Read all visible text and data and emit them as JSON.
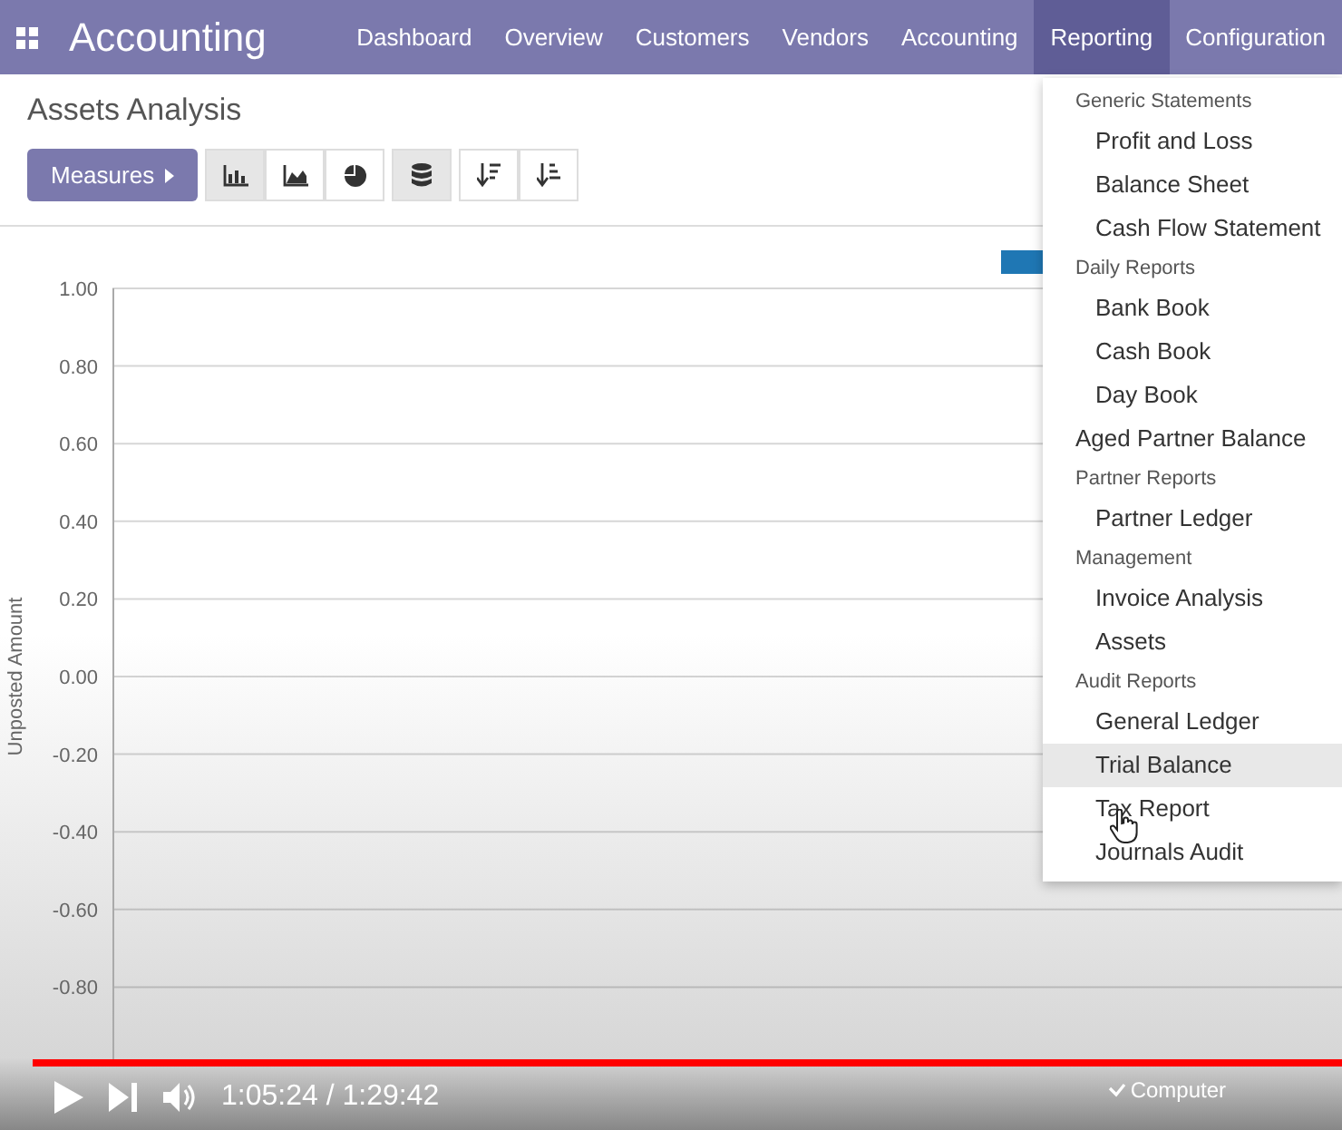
{
  "navbar": {
    "app_title": "Accounting",
    "menu": [
      {
        "label": "Dashboard",
        "selected": false
      },
      {
        "label": "Overview",
        "selected": false
      },
      {
        "label": "Customers",
        "selected": false
      },
      {
        "label": "Vendors",
        "selected": false
      },
      {
        "label": "Accounting",
        "selected": false
      },
      {
        "label": "Reporting",
        "selected": true
      },
      {
        "label": "Configuration",
        "selected": false
      }
    ]
  },
  "control_panel": {
    "title": "Assets Analysis",
    "measures_button": "Measures",
    "chart_types": [
      {
        "kind": "bar",
        "selected": true
      },
      {
        "kind": "line",
        "selected": false
      },
      {
        "kind": "pie",
        "selected": false
      }
    ],
    "stacked": {
      "selected": true
    },
    "sort_buttons": [
      {
        "kind": "descending"
      },
      {
        "kind": "ascending"
      }
    ]
  },
  "chart": {
    "chart_data": {
      "type": "bar",
      "ylabel": "Unposted Amount",
      "ylim": [
        -1,
        1
      ],
      "yticks": [
        {
          "value": 1,
          "label": "1.00"
        },
        {
          "value": 0.8,
          "label": "0.80"
        },
        {
          "value": 0.6,
          "label": "0.60"
        },
        {
          "value": 0.4,
          "label": "0.40"
        },
        {
          "value": 0.2,
          "label": "0.20"
        },
        {
          "value": 0,
          "label": "0.00"
        },
        {
          "value": -0.2,
          "label": "-0.20"
        },
        {
          "value": -0.4,
          "label": "-0.40"
        },
        {
          "value": -0.6,
          "label": "-0.60"
        },
        {
          "value": -0.8,
          "label": "-0.80"
        }
      ],
      "grid": true,
      "series": [
        {
          "color": "#1f77b4"
        }
      ]
    }
  },
  "reporting_menu": [
    {
      "kind": "header",
      "label": "Generic Statements"
    },
    {
      "kind": "item",
      "label": "Profit and Loss",
      "selected": false
    },
    {
      "kind": "item",
      "label": "Balance Sheet",
      "selected": false
    },
    {
      "kind": "item",
      "label": "Cash Flow Statement",
      "selected": false
    },
    {
      "kind": "header",
      "label": "Daily Reports"
    },
    {
      "kind": "item",
      "label": "Bank Book",
      "selected": false
    },
    {
      "kind": "item",
      "label": "Cash Book",
      "selected": false
    },
    {
      "kind": "item",
      "label": "Day Book",
      "selected": false
    },
    {
      "kind": "top",
      "label": "Aged Partner Balance"
    },
    {
      "kind": "header",
      "label": "Partner Reports"
    },
    {
      "kind": "item",
      "label": "Partner Ledger",
      "selected": false
    },
    {
      "kind": "header",
      "label": "Management"
    },
    {
      "kind": "item",
      "label": "Invoice Analysis",
      "selected": false
    },
    {
      "kind": "item",
      "label": "Assets",
      "selected": false
    },
    {
      "kind": "header",
      "label": "Audit Reports"
    },
    {
      "kind": "item",
      "label": "General Ledger",
      "selected": false
    },
    {
      "kind": "item",
      "label": "Trial Balance",
      "selected": true
    },
    {
      "kind": "item",
      "label": "Tax Report",
      "selected": false
    },
    {
      "kind": "item",
      "label": "Journals Audit",
      "selected": false
    }
  ],
  "video_player": {
    "progress": {
      "level": 1
    },
    "time": "1:05:24 / 1:29:42",
    "caption": "Computer"
  }
}
